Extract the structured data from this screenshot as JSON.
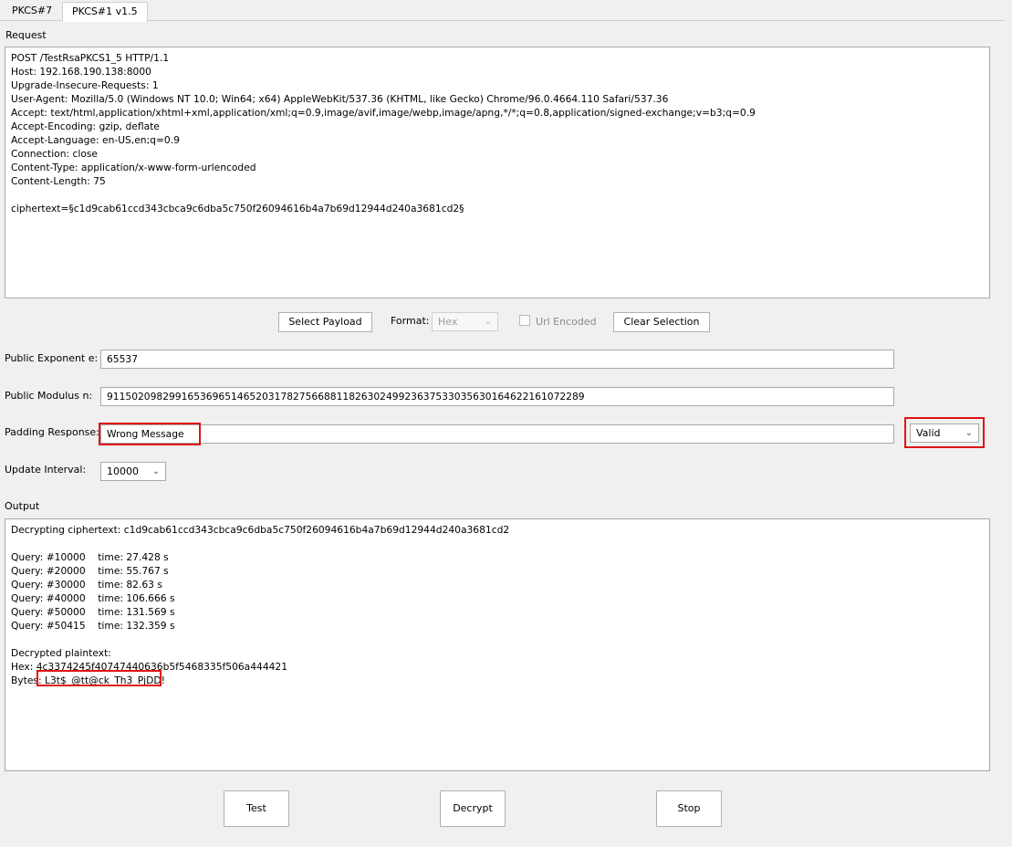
{
  "tabs": [
    {
      "label": "PKCS#7",
      "active": false
    },
    {
      "label": "PKCS#1 v1.5",
      "active": true
    }
  ],
  "request": {
    "label": "Request",
    "text": "POST /TestRsaPKCS1_5 HTTP/1.1\nHost: 192.168.190.138:8000\nUpgrade-Insecure-Requests: 1\nUser-Agent: Mozilla/5.0 (Windows NT 10.0; Win64; x64) AppleWebKit/537.36 (KHTML, like Gecko) Chrome/96.0.4664.110 Safari/537.36\nAccept: text/html,application/xhtml+xml,application/xml;q=0.9,image/avif,image/webp,image/apng,*/*;q=0.8,application/signed-exchange;v=b3;q=0.9\nAccept-Encoding: gzip, deflate\nAccept-Language: en-US,en;q=0.9\nConnection: close\nContent-Type: application/x-www-form-urlencoded\nContent-Length: 75\n\nciphertext=§c1d9cab61ccd343cbca9c6dba5c750f26094616b4a7b69d12944d240a3681cd2§"
  },
  "toolbar": {
    "select_payload_label": "Select Payload",
    "format_label": "Format:",
    "format_value": "Hex",
    "url_encoded_label": "Url Encoded",
    "url_encoded_checked": false,
    "clear_selection_label": "Clear Selection"
  },
  "params": {
    "exponent_label": "Public Exponent e:",
    "exponent_value": "65537",
    "modulus_label": "Public Modulus n:",
    "modulus_value": "9115020982991653696514652031782756688118263024992363753303563016462216107228​9",
    "padding_label": "Padding Response:",
    "padding_value": "Wrong Message",
    "padding_type": "Valid",
    "interval_label": "Update Interval:",
    "interval_value": "10000"
  },
  "output": {
    "label": "Output",
    "text_before": "Decrypting ciphertext: c1d9cab61ccd343cbca9c6dba5c750f26094616b4a7b69d12944d240a3681cd2\n\nQuery: #10000    time: 27.428 s\nQuery: #20000    time: 55.767 s\nQuery: #30000    time: 82.63 s\nQuery: #40000    time: 106.666 s\nQuery: #50000    time: 131.569 s\nQuery: #50415    time: 132.359 s\n\nDecrypted plaintext:\nHex: 4c3374245f40747440636b5f5468335f506a444421\nBytes: ",
    "plaintext_bytes": "L3t$_@tt@ck_Th3_PjDD!"
  },
  "actions": {
    "test_label": "Test",
    "decrypt_label": "Decrypt",
    "stop_label": "Stop"
  },
  "colors": {
    "highlight": "#e01414",
    "background": "#f0f0f0"
  }
}
